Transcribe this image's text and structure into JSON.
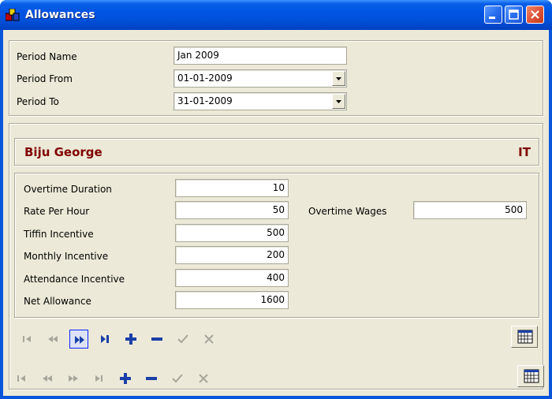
{
  "window": {
    "title": "Allowances",
    "icon": "app-icon"
  },
  "title_buttons": {
    "minimize": "minimize-icon",
    "maximize": "maximize-icon",
    "close": "close-icon"
  },
  "period": {
    "name_label": "Period Name",
    "name_value": "Jan 2009",
    "from_label": "Period From",
    "from_value": "01-01-2009",
    "to_label": "Period To",
    "to_value": "31-01-2009"
  },
  "employee": {
    "name": "Biju George",
    "department": "IT"
  },
  "allowances": {
    "overtime_duration_label": "Overtime Duration",
    "overtime_duration": "10",
    "rate_per_hour_label": "Rate Per Hour",
    "rate_per_hour": "50",
    "tiffin_incentive_label": "Tiffin Incentive",
    "tiffin_incentive": "500",
    "monthly_incentive_label": "Monthly Incentive",
    "monthly_incentive": "200",
    "attendance_incentive_label": "Attendance Incentive",
    "attendance_incentive": "400",
    "net_allowance_label": "Net Allowance",
    "net_allowance": "1600",
    "overtime_wages_label": "Overtime Wages",
    "overtime_wages": "500"
  },
  "navigators": {
    "inner": [
      "first-record-icon",
      "prior-page-icon",
      "next-page-icon",
      "last-record-icon",
      "insert-icon",
      "delete-icon",
      "post-icon",
      "cancel-icon",
      "calendar-icon"
    ],
    "outer": [
      "first-record-icon",
      "prior-page-icon",
      "next-page-icon",
      "last-record-icon",
      "insert-icon",
      "delete-icon",
      "post-icon",
      "cancel-icon",
      "calendar-icon"
    ]
  },
  "colors": {
    "title_bar": "#0054e3",
    "client": "#ece9d8",
    "employee_text": "#800000",
    "nav_blue": "#1a3fa8",
    "nav_disabled": "#a7a69a"
  }
}
